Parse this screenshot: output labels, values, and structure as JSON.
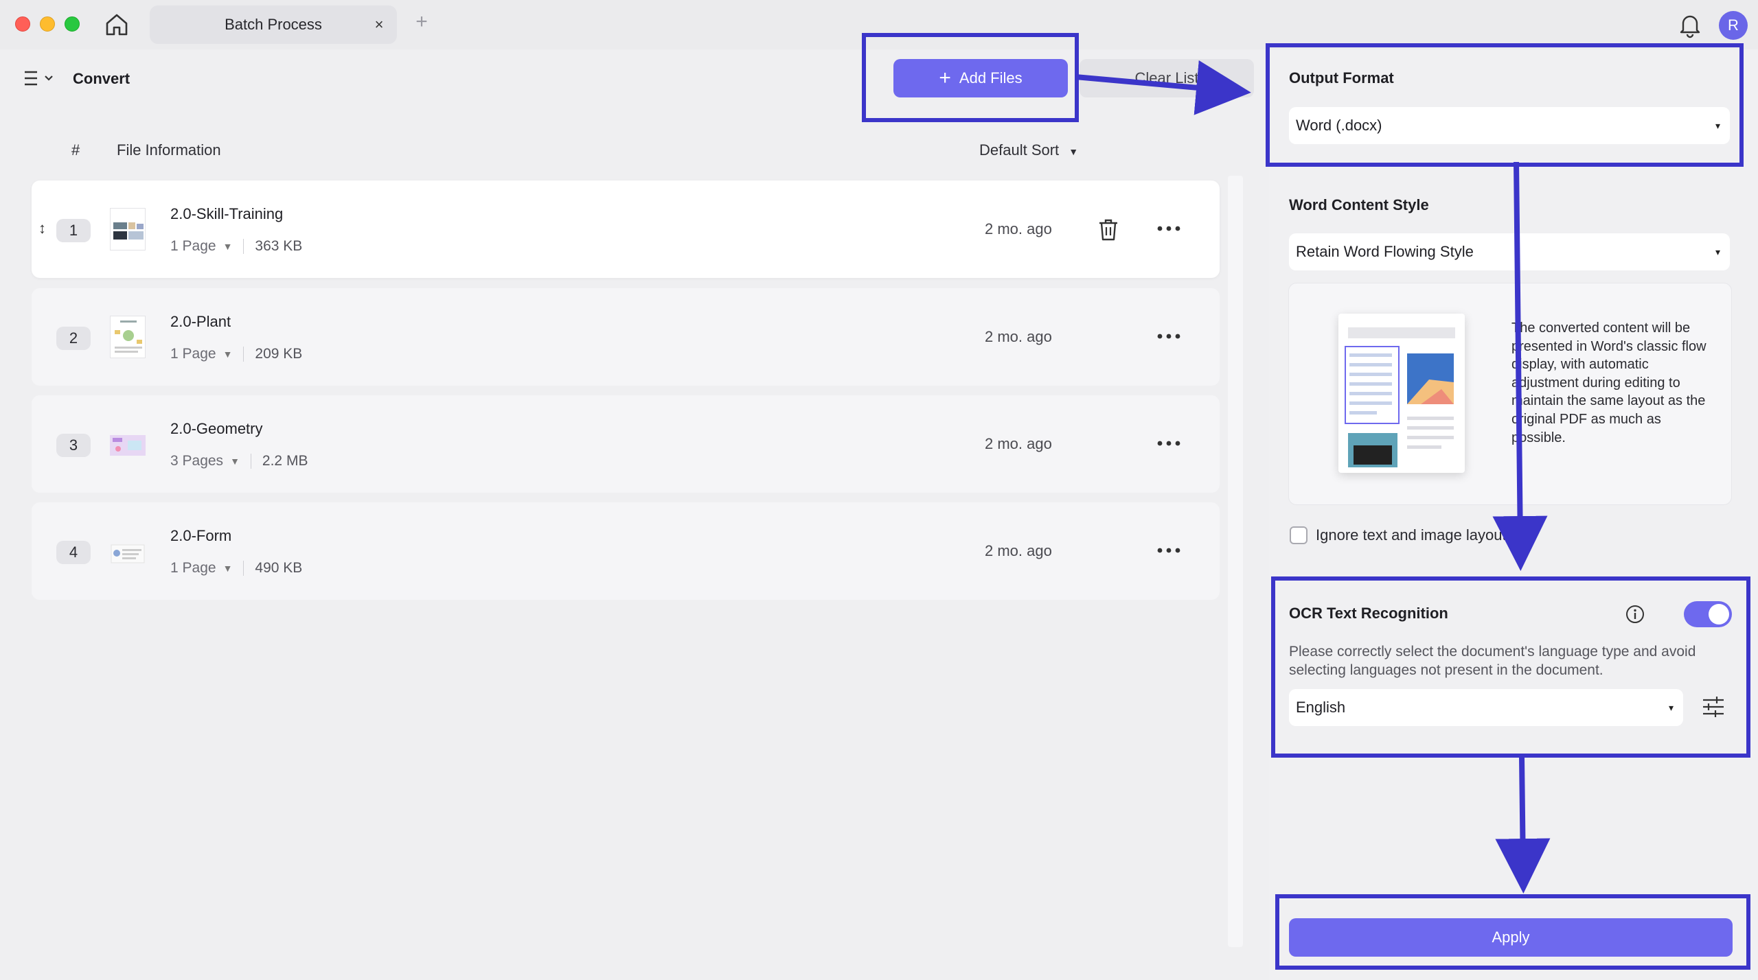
{
  "titlebar": {
    "tab_label": "Batch Process",
    "tab_close": "×",
    "tab_add": "+",
    "avatar_initial": "R"
  },
  "toolbar": {
    "title": "Convert",
    "add_files_label": "Add Files",
    "add_files_icon": "+",
    "clear_list_label": "Clear List"
  },
  "list": {
    "col_number": "#",
    "col_info": "File Information",
    "sort_label": "Default Sort",
    "sort_chevron": "⌄",
    "rows": [
      {
        "num": "1",
        "name": "2.0-Skill-Training",
        "pages": "1 Page",
        "size": "363 KB",
        "time": "2 mo. ago"
      },
      {
        "num": "2",
        "name": "2.0-Plant",
        "pages": "1 Page",
        "size": "209 KB",
        "time": "2 mo. ago"
      },
      {
        "num": "3",
        "name": "2.0-Geometry",
        "pages": "3 Pages",
        "size": "2.2 MB",
        "time": "2 mo. ago"
      },
      {
        "num": "4",
        "name": "2.0-Form",
        "pages": "1 Page",
        "size": "490 KB",
        "time": "2 mo. ago"
      }
    ],
    "drag_handle": "↕",
    "page_chevron": "⌄"
  },
  "side": {
    "output_format_title": "Output Format",
    "output_format_value": "Word (.docx)",
    "word_style_title": "Word Content Style",
    "word_style_value": "Retain Word Flowing Style",
    "preview_description": "The converted content will be presented in Word's classic flow display, with automatic adjustment during editing to maintain the same layout as the original PDF as much as possible.",
    "ignore_layout_label": "Ignore text and image layout",
    "ignore_layout_checked": false,
    "ocr_title": "OCR Text Recognition",
    "ocr_enabled": true,
    "ocr_description": "Please correctly select the document's language type and avoid selecting languages not present in the document.",
    "ocr_language": "English",
    "select_caret": "▾",
    "apply_label": "Apply"
  },
  "colors": {
    "accent": "#6e69ee",
    "annotation": "#3b35c9"
  }
}
